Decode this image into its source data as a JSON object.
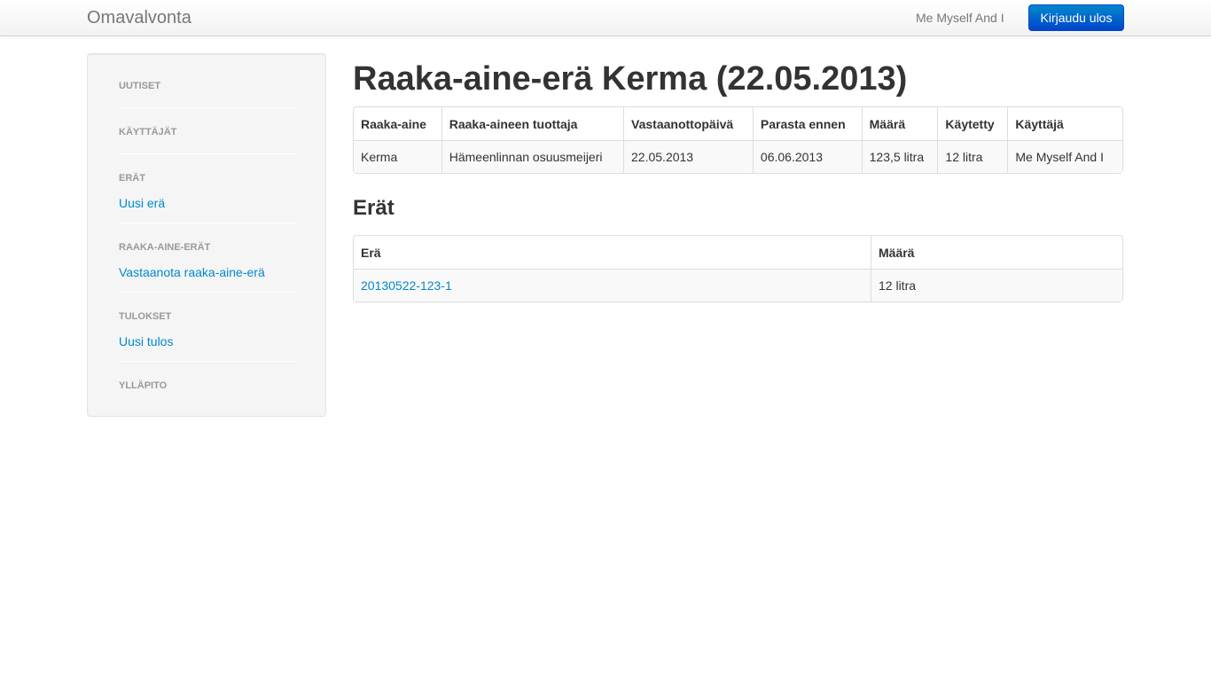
{
  "navbar": {
    "brand": "Omavalvonta",
    "user": "Me Myself And I",
    "logout_label": "Kirjaudu ulos"
  },
  "sidebar": {
    "sections": [
      {
        "header": "UUTISET",
        "links": []
      },
      {
        "header": "KÄYTTÄJÄT",
        "links": []
      },
      {
        "header": "ERÄT",
        "links": [
          "Uusi erä"
        ]
      },
      {
        "header": "RAAKA-AINE-ERÄT",
        "links": [
          "Vastaanota raaka-aine-erä"
        ]
      },
      {
        "header": "TULOKSET",
        "links": [
          "Uusi tulos"
        ]
      },
      {
        "header": "YLLÄPITO",
        "links": []
      }
    ]
  },
  "main": {
    "title": "Raaka-aine-erä Kerma (22.05.2013)",
    "details_table": {
      "headers": [
        "Raaka-aine",
        "Raaka-aineen tuottaja",
        "Vastaanottopäivä",
        "Parasta ennen",
        "Määrä",
        "Käytetty",
        "Käyttäjä"
      ],
      "row": [
        "Kerma",
        "Hämeenlinnan osuusmeijeri",
        "22.05.2013",
        "06.06.2013",
        "123,5 litra",
        "12 litra",
        "Me Myself And I"
      ]
    },
    "batches_title": "Erät",
    "batches_table": {
      "headers": [
        "Erä",
        "Määrä"
      ],
      "rows": [
        {
          "batch": "20130522-123-1",
          "amount": "12 litra"
        }
      ]
    }
  },
  "colors": {
    "link": "#0088cc",
    "button_primary": "#0055cc",
    "sidebar_bg": "#f5f5f5"
  }
}
